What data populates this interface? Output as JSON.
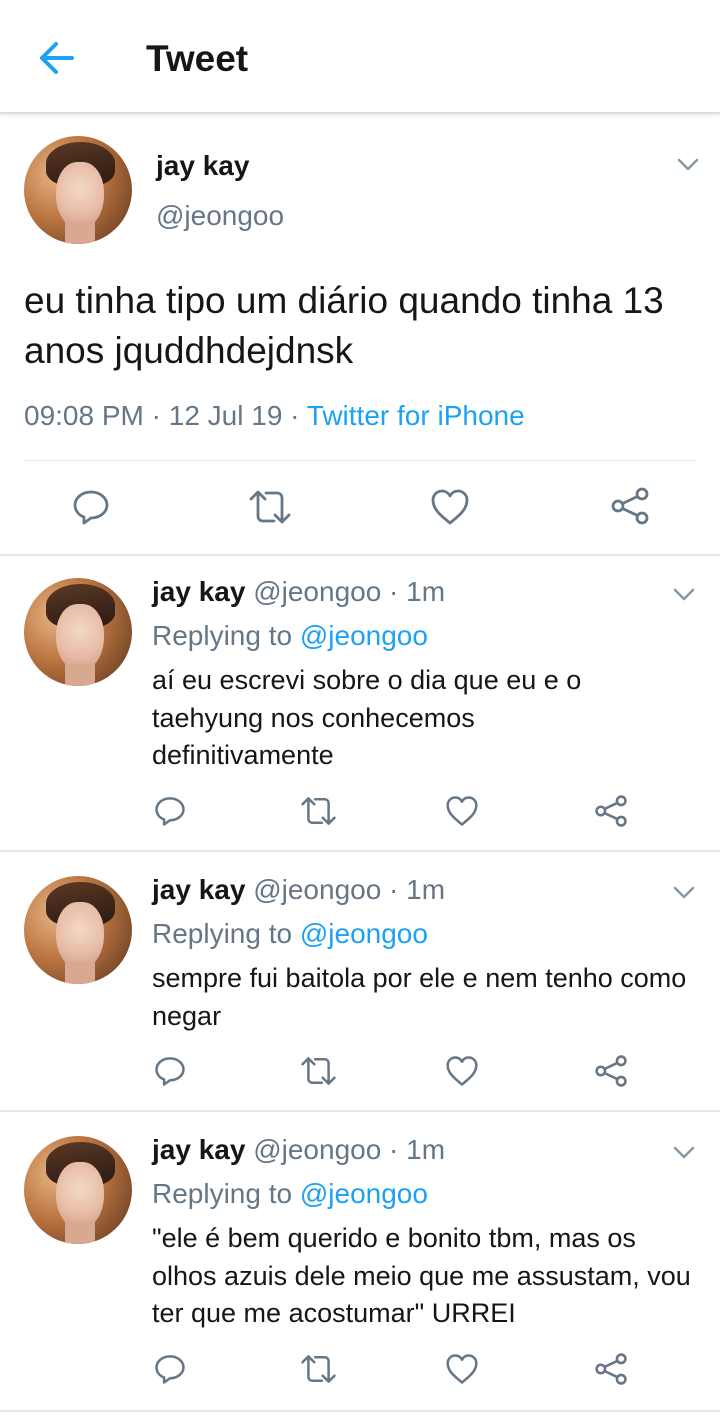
{
  "header": {
    "title": "Tweet"
  },
  "main_tweet": {
    "name": "jay kay",
    "handle": "@jeongoo",
    "text": "eu tinha tipo um diário quando tinha 13 anos jquddhdejdnsk",
    "time": "09:08 PM",
    "sep1": " · ",
    "date": "12 Jul 19",
    "sep2": " · ",
    "source": "Twitter for iPhone"
  },
  "replies": [
    {
      "name": "jay kay",
      "handle_time": " @jeongoo · 1m",
      "replying_prefix": "Replying to ",
      "replying_to": "@jeongoo",
      "text": "aí eu escrevi sobre o dia que eu e o taehyung nos conhecemos definitivamente"
    },
    {
      "name": "jay kay",
      "handle_time": " @jeongoo · 1m",
      "replying_prefix": "Replying to ",
      "replying_to": "@jeongoo",
      "text": "sempre fui baitola por ele e nem tenho como negar"
    },
    {
      "name": "jay kay",
      "handle_time": " @jeongoo · 1m",
      "replying_prefix": "Replying to ",
      "replying_to": "@jeongoo",
      "text": "\"ele é bem querido e bonito tbm, mas os olhos azuis dele meio que me assustam, vou ter que me acostumar\" URREI"
    }
  ],
  "colors": {
    "accent": "#1da1f2",
    "secondary_text": "#657786",
    "icon": "#657786",
    "divider": "#e1e8ed"
  },
  "icons": [
    "back-arrow-icon",
    "chevron-down-icon",
    "reply-icon",
    "retweet-icon",
    "like-icon",
    "share-icon"
  ]
}
